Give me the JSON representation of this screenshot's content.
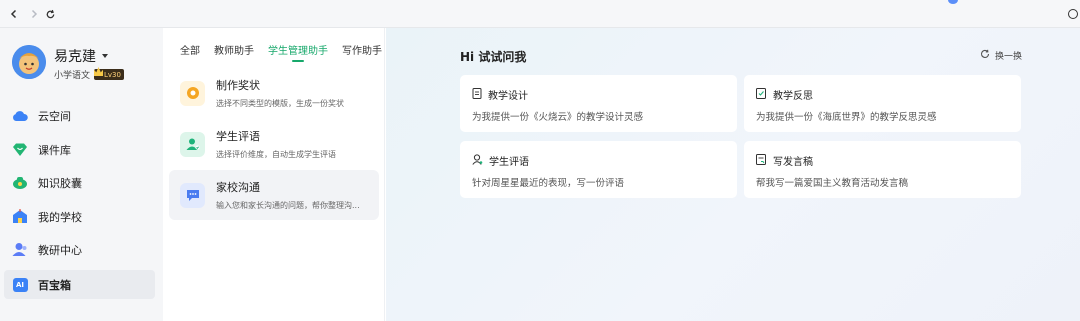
{
  "sidebar": {
    "user": {
      "name": "易克建",
      "subject": "小学语文",
      "level": "Lv30"
    },
    "items": [
      {
        "label": "云空间",
        "icon": "cloud-icon",
        "color": "#3b82f6"
      },
      {
        "label": "课件库",
        "icon": "heart-diamond-icon",
        "color": "#22b573"
      },
      {
        "label": "知识胶囊",
        "icon": "capsule-icon",
        "color": "#22b573"
      },
      {
        "label": "我的学校",
        "icon": "school-icon",
        "color": "#3b82f6"
      },
      {
        "label": "教研中心",
        "icon": "people-icon",
        "color": "#5b7cf6"
      },
      {
        "label": "百宝箱",
        "icon": "ai-box-icon",
        "color": "#3b82f6",
        "badge": "AI"
      }
    ]
  },
  "tabs": [
    "全部",
    "教师助手",
    "学生管理助手",
    "写作助手"
  ],
  "tools": [
    {
      "title": "制作奖状",
      "desc": "选择不同类型的模版，生成一份奖状",
      "icon": "award-icon",
      "color": "#f5a623",
      "bg": "#fff4dc"
    },
    {
      "title": "学生评语",
      "desc": "选择评价维度，自动生成学生评语",
      "icon": "student-comment-icon",
      "color": "#1fb37a",
      "bg": "#ddf5ea"
    },
    {
      "title": "家校沟通",
      "desc": "输入您和家长沟通的问题，帮你整理沟...",
      "icon": "chat-icon",
      "color": "#4a7cf0",
      "bg": "#e1e9fd"
    }
  ],
  "main": {
    "greeting": "Hi 试试问我",
    "refresh_label": "换一换",
    "cards": [
      {
        "title": "教学设计",
        "desc": "为我提供一份《火烧云》的教学设计灵感",
        "icon": "document-icon"
      },
      {
        "title": "教学反思",
        "desc": "为我提供一份《海底世界》的教学反思灵感",
        "icon": "reflection-icon"
      },
      {
        "title": "学生评语",
        "desc": "针对周星星最近的表现，写一份评语",
        "icon": "person-icon"
      },
      {
        "title": "写发言稿",
        "desc": "帮我写一篇爱国主义教育活动发言稿",
        "icon": "speech-icon"
      }
    ]
  }
}
